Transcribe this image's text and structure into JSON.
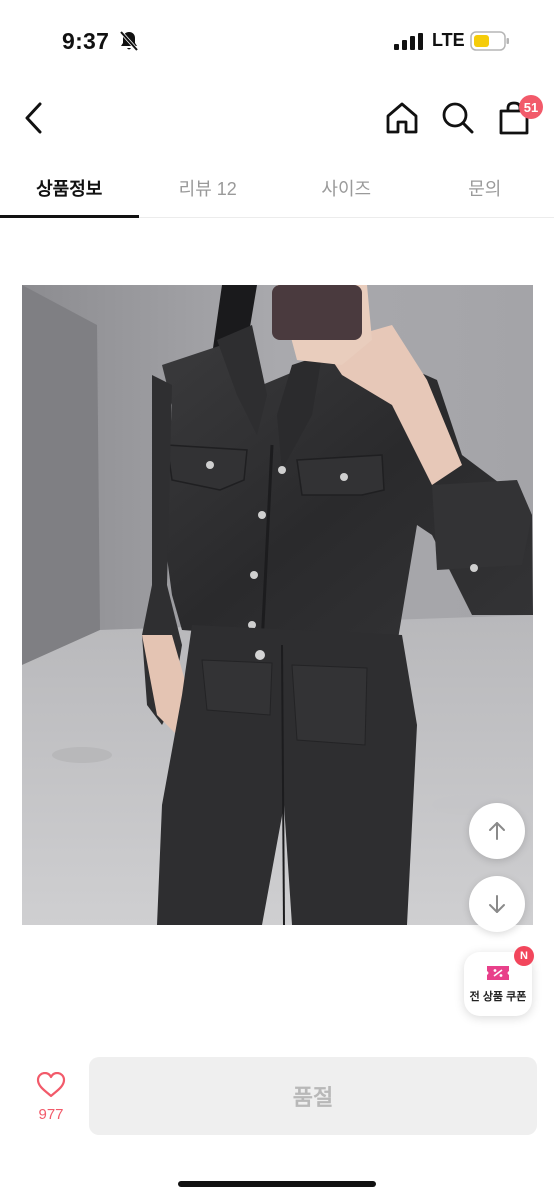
{
  "status_bar": {
    "time": "9:37",
    "network": "LTE",
    "icons": [
      "bell-off-icon",
      "signal-icon",
      "battery-icon"
    ]
  },
  "header": {
    "icons": [
      "back-arrow-icon",
      "home-icon",
      "search-icon",
      "shopping-bag-icon"
    ],
    "cart_count": "51"
  },
  "tabs": [
    {
      "label": "상품정보",
      "active": true
    },
    {
      "label": "리뷰 12",
      "active": false
    },
    {
      "label": "사이즈",
      "active": false
    },
    {
      "label": "문의",
      "active": false
    }
  ],
  "floating": {
    "scroll_up_icon": "arrow-up-icon",
    "scroll_down_icon": "arrow-down-icon",
    "coupon_label": "전 상품 쿠폰",
    "coupon_badge": "N"
  },
  "bottom_bar": {
    "like_count": "977",
    "purchase_label": "품절"
  },
  "colors": {
    "accent": "#f25a6a",
    "coupon_pink": "#e8408a",
    "disabled_bg": "#efefef",
    "disabled_text": "#b8b8b8"
  }
}
